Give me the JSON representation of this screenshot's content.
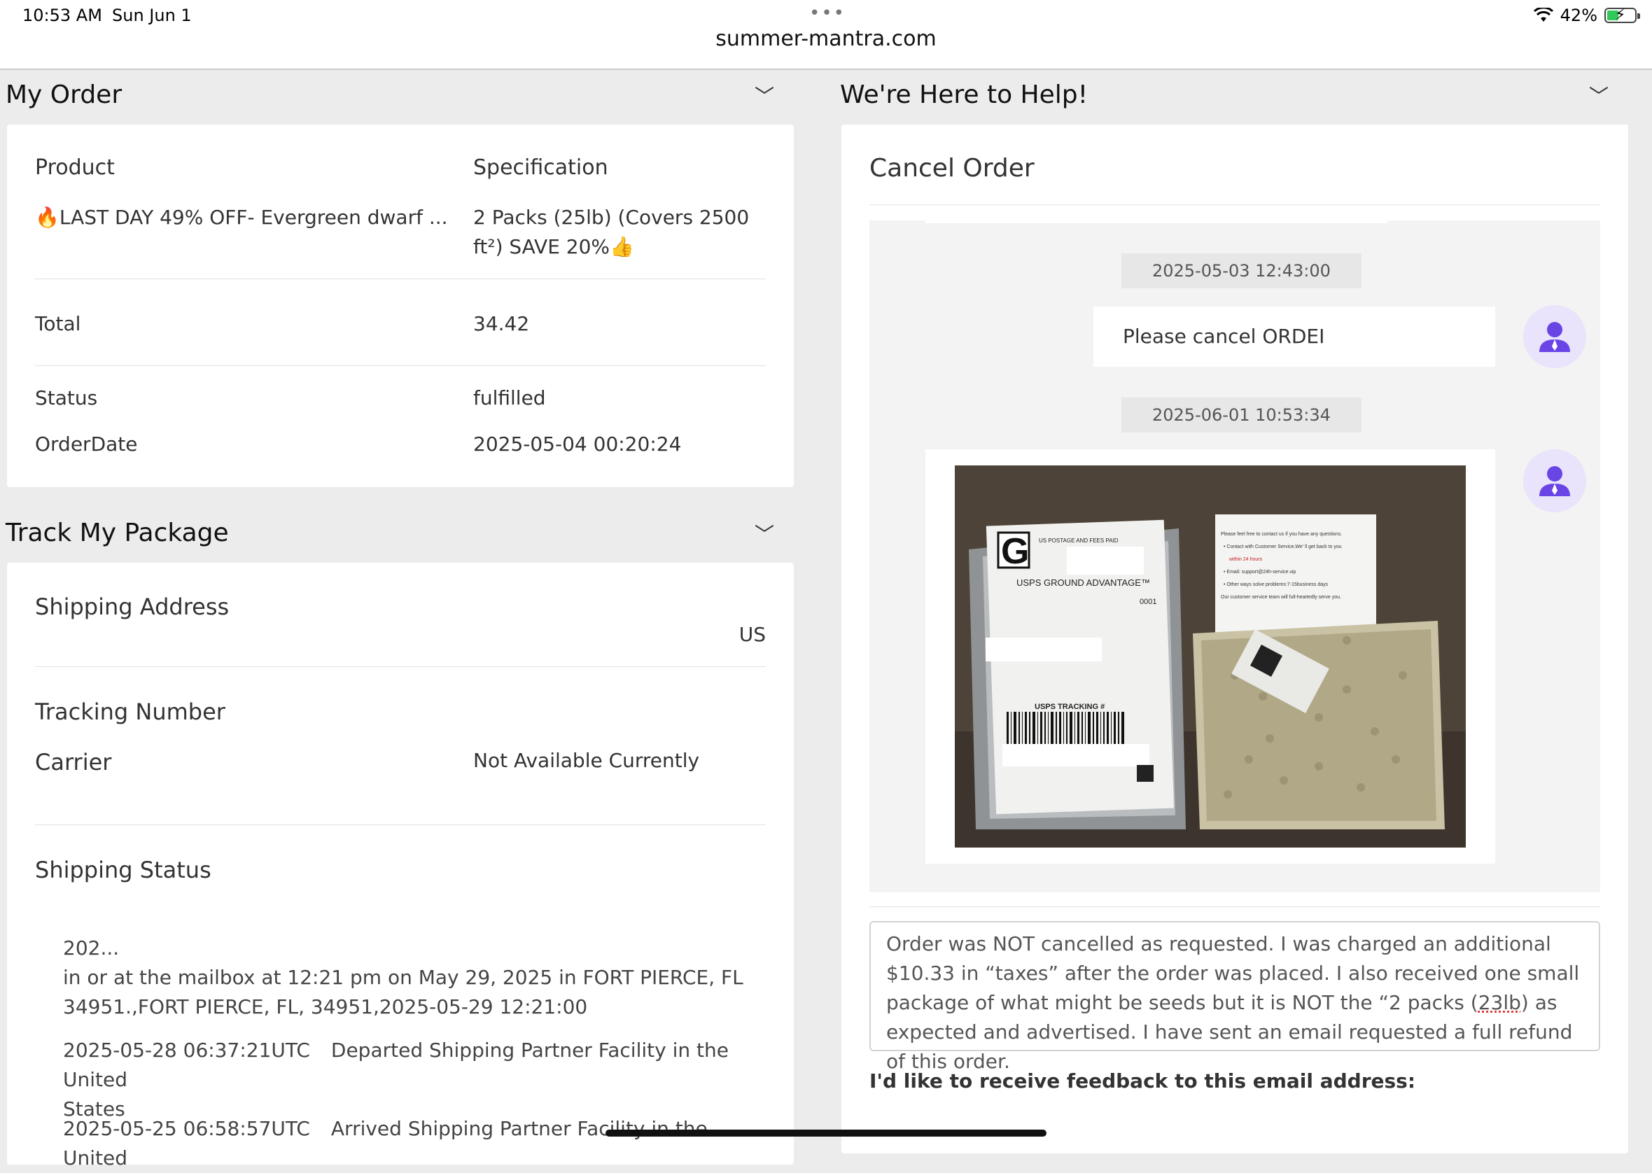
{
  "status_bar": {
    "time": "10:53 AM",
    "date": "Sun Jun 1",
    "url": "summer-mantra.com",
    "battery": "42%",
    "battery_level": 0.42
  },
  "my_order": {
    "title": "My Order",
    "product_label": "Product",
    "spec_label": "Specification",
    "product_name": "🔥LAST DAY 49% OFF- Evergreen dwarf ...",
    "spec_line1": "2 Packs (25lb) (Covers 2500",
    "spec_line2": "ft²)  SAVE 20%👍",
    "total_label": "Total",
    "total_value": "34.42",
    "status_label": "Status",
    "status_value": "fulfilled",
    "orderdate_label": "OrderDate",
    "orderdate_value": "2025-05-04 00:20:24"
  },
  "track": {
    "title": "Track My Package",
    "shipping_address_label": "Shipping Address",
    "shipping_address_value": "US",
    "tracking_number_label": "Tracking Number",
    "carrier_label": "Carrier",
    "carrier_value": "Not Available Currently",
    "shipping_status_label": "Shipping Status",
    "events": [
      {
        "line1": "202...",
        "line2": "in or at the mailbox at 12:21 pm on May 29, 2025 in FORT PIERCE, FL",
        "line3": "34951.,FORT PIERCE, FL, 34951,2025-05-29 12:21:00"
      },
      {
        "date": "2025-05-28 06:37:21UTC",
        "desc": "Departed Shipping Partner Facility in the United",
        "desc2": "States"
      },
      {
        "date": "2025-05-25 06:58:57UTC",
        "desc": "Arrived Shipping Partner Facility in the United"
      }
    ]
  },
  "help": {
    "title": "We're Here to Help!",
    "cancel_title": "Cancel Order",
    "stamp1": "2025-05-03 12:43:00",
    "message1": "Please cancel ORDEI",
    "stamp2": "2025-06-01 10:53:34",
    "comment": "Order was NOT cancelled as requested. I was charged an additional $10.33 in “taxes” after the order was placed. I also received one small package of what might be seeds but it is NOT the “2 packs (",
    "comment_sq": "23lb",
    "comment_end": ") as expected and advertised. I have sent an email requested a full refund of this order.",
    "feedback_label": "I'd like to receive feedback to this email address:"
  },
  "photo": {
    "label_g": "G",
    "postage": "US POSTAGE AND FEES PAID",
    "service": "USPS GROUND ADVANTAGE™",
    "code": "0001",
    "tracking_hdr": "USPS TRACKING #",
    "note_lines": [
      "Please feel free to contact us if you have any questions.",
      "• Contact with Customer Service,We' ll get back to you",
      "within 24 hours",
      "• Email: support@24h-service.vip",
      "• Other ways solve problems:7-15business days",
      "Our customer service team will full-heartedly serve you."
    ]
  },
  "icons": [
    "wifi-icon",
    "battery-icon",
    "chevron-down-icon",
    "user-avatar-icon"
  ]
}
